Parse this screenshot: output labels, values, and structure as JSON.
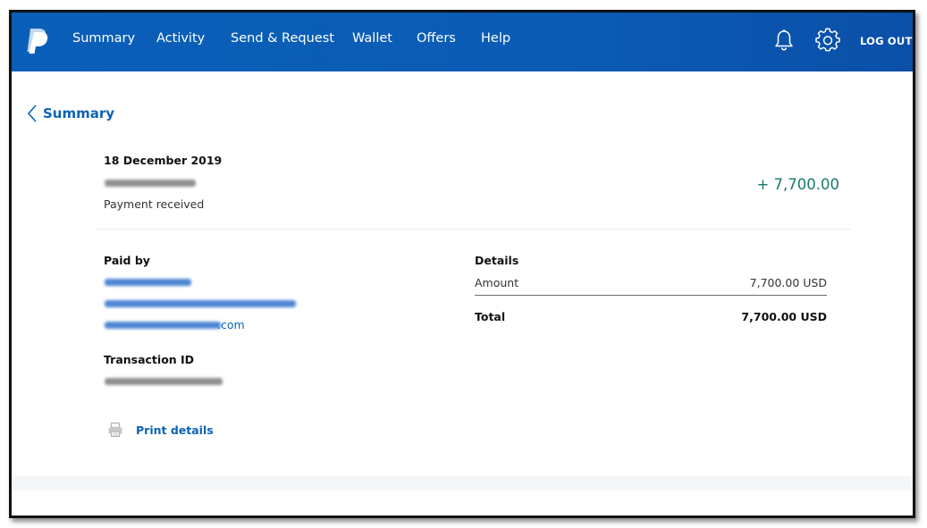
{
  "nav": {
    "items": [
      {
        "label": "Summary",
        "name": "nav-summary"
      },
      {
        "label": "Activity",
        "name": "nav-activity"
      },
      {
        "label": "Send & Request",
        "name": "nav-send-request"
      },
      {
        "label": "Wallet",
        "name": "nav-wallet"
      },
      {
        "label": "Offers",
        "name": "nav-offers"
      },
      {
        "label": "Help",
        "name": "nav-help"
      }
    ],
    "logout_label": "LOG OUT",
    "icons": [
      "bell-icon",
      "gear-icon"
    ]
  },
  "back": {
    "label": "Summary"
  },
  "transaction": {
    "date": "18 December 2019",
    "status": "Payment received",
    "amount": "+ 7,700.00"
  },
  "paid_by": {
    "heading": "Paid by",
    "email_suffix": ".com"
  },
  "transaction_id": {
    "heading": "Transaction ID"
  },
  "details": {
    "heading": "Details",
    "amount_label": "Amount",
    "amount_value": "7,700.00 USD",
    "total_label": "Total",
    "total_value": "7,700.00 USD"
  },
  "print": {
    "label": "Print details"
  },
  "colors": {
    "brand_blue": "#0a5fb8",
    "link_blue": "#0b63b5",
    "positive_green": "#167a6a"
  }
}
